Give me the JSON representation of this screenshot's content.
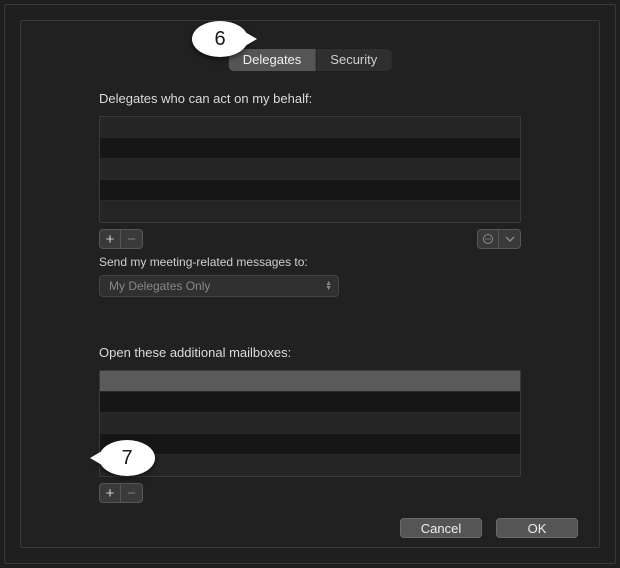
{
  "tabs": {
    "delegates": "Delegates",
    "security": "Security"
  },
  "delegates_section": {
    "label": "Delegates who can act on my behalf:",
    "rows": [
      "",
      "",
      "",
      "",
      ""
    ],
    "send_label": "Send my meeting-related messages to:",
    "send_value": "My Delegates Only"
  },
  "mailboxes_section": {
    "label": "Open these additional mailboxes:",
    "rows": [
      "",
      "",
      "",
      "",
      ""
    ]
  },
  "buttons": {
    "add": "+",
    "remove": "−",
    "cancel": "Cancel",
    "ok": "OK"
  },
  "callouts": {
    "six": "6",
    "seven": "7"
  }
}
